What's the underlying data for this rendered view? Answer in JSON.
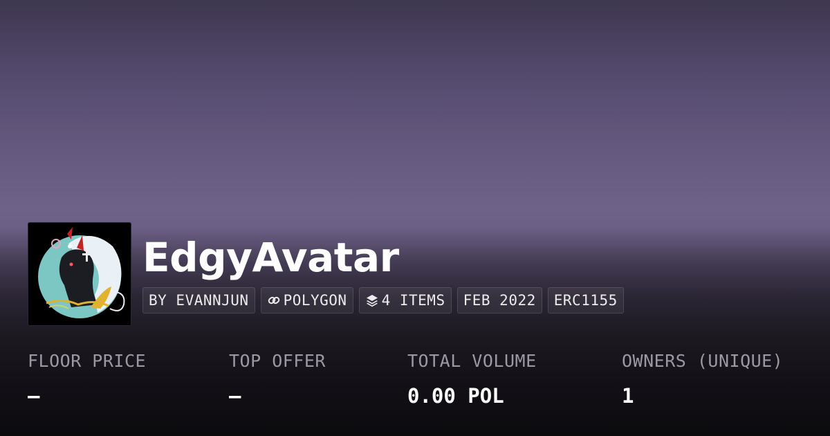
{
  "collection": {
    "name": "EdgyAvatar",
    "avatar_icon": "collection-avatar-image",
    "tags": [
      {
        "label": "BY EVANNJUN",
        "icon": null
      },
      {
        "label": "POLYGON",
        "icon": "chain-link-icon"
      },
      {
        "label": "4 ITEMS",
        "icon": "layers-icon"
      },
      {
        "label": "FEB 2022",
        "icon": null
      },
      {
        "label": "ERC1155",
        "icon": null
      }
    ]
  },
  "stats": [
    {
      "label": "FLOOR PRICE",
      "value": "–"
    },
    {
      "label": "TOP OFFER",
      "value": "–"
    },
    {
      "label": "TOTAL VOLUME",
      "value": "0.00 POL"
    },
    {
      "label": "OWNERS (UNIQUE)",
      "value": "1"
    }
  ],
  "colors": {
    "text_primary": "#ffffff",
    "text_muted": "#9c98a4",
    "banner_purple": "#6f6289"
  }
}
